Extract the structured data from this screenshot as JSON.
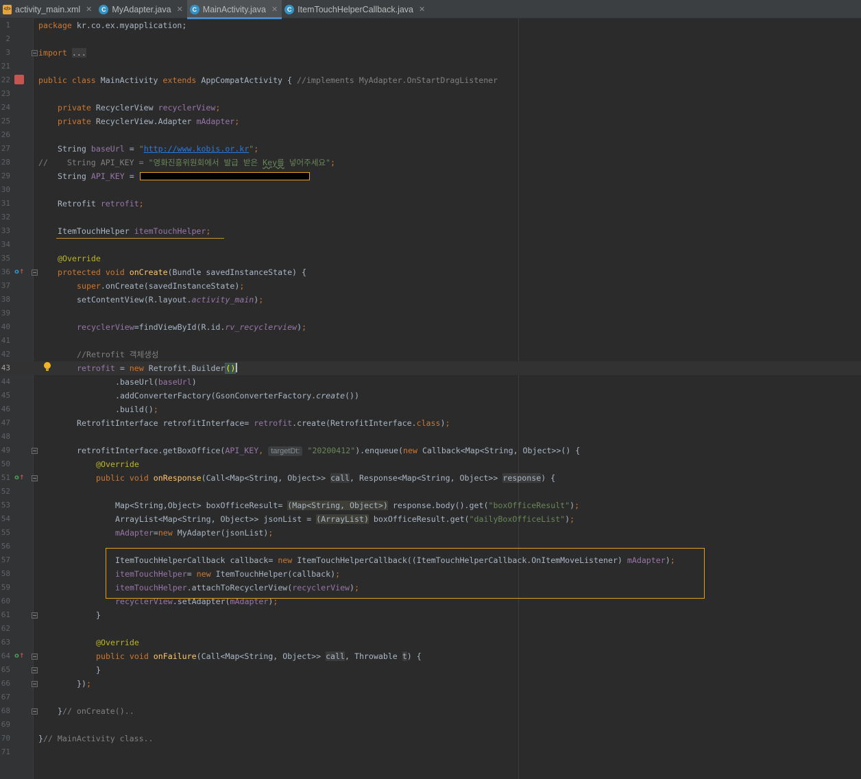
{
  "tabs": [
    {
      "label": "activity_main.xml",
      "icon": "xml-file-icon",
      "active": false
    },
    {
      "label": "MyAdapter.java",
      "icon": "java-class-icon",
      "active": false
    },
    {
      "label": "MainActivity.java",
      "icon": "java-class-icon",
      "active": true
    },
    {
      "label": "ItemTouchHelperCallback.java",
      "icon": "java-class-icon",
      "active": false
    }
  ],
  "editor": {
    "current_line": "43",
    "line_numbers": [
      "1",
      "2",
      "3",
      "21",
      "22",
      "23",
      "24",
      "25",
      "26",
      "27",
      "28",
      "29",
      "30",
      "31",
      "32",
      "33",
      "34",
      "35",
      "36",
      "37",
      "38",
      "39",
      "40",
      "41",
      "42",
      "43",
      "44",
      "45",
      "46",
      "47",
      "48",
      "49",
      "50",
      "51",
      "52",
      "53",
      "54",
      "55",
      "56",
      "57",
      "58",
      "59",
      "60",
      "61",
      "62",
      "63",
      "64",
      "65",
      "66",
      "67",
      "68",
      "69",
      "70",
      "71"
    ],
    "code": {
      "l1": {
        "kw": "package",
        "pkg": " kr.co.ex.myapplication;"
      },
      "l3": {
        "kw": "import",
        "fold": "..."
      },
      "l22": {
        "kw1": "public",
        "kw2": "class",
        "name": " MainActivity ",
        "kw3": "extends",
        "parent": " AppCompatActivity { ",
        "comment": "//implements MyAdapter.OnStartDragListener"
      },
      "l24": {
        "kw": "private",
        "type": " RecyclerView ",
        "field": "recyclerView",
        "end": ";"
      },
      "l25": {
        "kw": "private",
        "type": " RecyclerView.Adapter ",
        "field": "mAdapter",
        "end": ";"
      },
      "l27": {
        "type": "String ",
        "field": "baseUrl",
        "eq": " = ",
        "q1": "\"",
        "url": "http://www.kobis.or.kr",
        "q2": "\"",
        "end": ";"
      },
      "l28": {
        "comment_start": "//    String API_KEY = ",
        "str_a": "\"영화진흥위원회에서 발급 받은 ",
        "str_key": "Key를",
        "str_b": " 넣어주세요\"",
        "end": ";"
      },
      "l29": {
        "type": "String ",
        "field": "API_KEY",
        "eq": " ="
      },
      "l31": {
        "type": "Retrofit ",
        "field": "retrofit",
        "end": ";"
      },
      "l33": {
        "type": "ItemTouchHelper ",
        "field": "itemTouchHelper",
        "end": ";"
      },
      "l35": {
        "ann": "@Override"
      },
      "l36": {
        "kw1": "protected",
        "kw2": "void",
        "method": "onCreate",
        "args": "(Bundle savedInstanceState) {"
      },
      "l37": {
        "kw": "super",
        "rest": ".onCreate(savedInstanceState)",
        "end": ";"
      },
      "l38": {
        "pre": "setContentView(R.layout.",
        "field": "activity_main",
        "post": ")",
        "end": ";"
      },
      "l40": {
        "field": "recyclerView",
        "pre": "=findViewById(R.id.",
        "id": "rv_recyclerview",
        "post": ")",
        "end": ";"
      },
      "l42": {
        "comment": "//Retrofit 객체생성"
      },
      "l43": {
        "field": "retrofit",
        "eq": " = ",
        "kw": "new",
        "cls": " Retrofit.Builder",
        "paren": "()"
      },
      "l44": {
        "pre": ".baseUrl(",
        "field": "baseUrl",
        "post": ")"
      },
      "l45": {
        "pre": ".addConverterFactory(GsonConverterFactory.",
        "method": "create",
        "post": "())"
      },
      "l46": {
        "pre": ".build()",
        "end": ";"
      },
      "l47": {
        "pre": "RetrofitInterface retrofitInterface= ",
        "field": "retrofit",
        "mid": ".create(RetrofitInterface.",
        "kw": "class",
        "post": ")",
        "end": ";"
      },
      "l49": {
        "pre": "retrofitInterface.getBoxOffice(",
        "field": "API_KEY",
        "comma": ", ",
        "hint": "targetDt:",
        "str": " \"20200412\"",
        "mid": ").enqueue(",
        "kw": "new",
        "post": " Callback<Map<String, Object>>() {"
      },
      "l50": {
        "ann": "@Override"
      },
      "l51": {
        "kw1": "public",
        "kw2": "void",
        "method": "onResponse",
        "a": "(Call<Map<String, Object>> ",
        "p1": "call",
        "b": ", Response<Map<String, Object>> ",
        "p2": "response",
        "c": ") {"
      },
      "l53": {
        "pre": "Map<String,Object> boxOfficeResult= ",
        "cast": "(Map<String, Object>)",
        "mid": " response.body().get(",
        "str": "\"boxOfficeResult\"",
        "post": ")",
        "end": ";"
      },
      "l54": {
        "pre": "ArrayList<Map<String, Object>> jsonList = ",
        "cast": "(ArrayList)",
        "mid": " boxOfficeResult.get(",
        "str": "\"dailyBoxOfficeList\"",
        "post": ")",
        "end": ";"
      },
      "l55": {
        "field": "mAdapter",
        "eq": "=",
        "kw": "new",
        "post": " MyAdapter(jsonList)",
        "end": ";"
      },
      "l57": {
        "pre": "ItemTouchHelperCallback callback= ",
        "kw": "new",
        "mid": " ItemTouchHelperCallback((ItemTouchHelperCallback.OnItemMoveListener) ",
        "field": "mAdapter",
        "post": ")",
        "end": ";"
      },
      "l58": {
        "field": "itemTouchHelper",
        "eq": "= ",
        "kw": "new",
        "post": " ItemTouchHelper(callback)",
        "end": ";"
      },
      "l59": {
        "field": "itemTouchHelper",
        "mid": ".attachToRecyclerView(",
        "field2": "recyclerView",
        "post": ")",
        "end": ";"
      },
      "l60": {
        "field": "recyclerView",
        "mid": ".setAdapter(",
        "field2": "mAdapter",
        "post": ")",
        "end": ";"
      },
      "l61": {
        "text": "}"
      },
      "l63": {
        "ann": "@Override"
      },
      "l64": {
        "kw1": "public",
        "kw2": "void",
        "method": "onFailure",
        "a": "(Call<Map<String, Object>> ",
        "p1": "call",
        "b": ", Throwable ",
        "p2": "t",
        "c": ") {"
      },
      "l65": {
        "text": "}"
      },
      "l66": {
        "text": "})",
        "end": ";"
      },
      "l68": {
        "text": "}",
        "comment": "// onCreate().."
      },
      "l70": {
        "text": "}",
        "comment": "// MainActivity class.."
      }
    }
  }
}
